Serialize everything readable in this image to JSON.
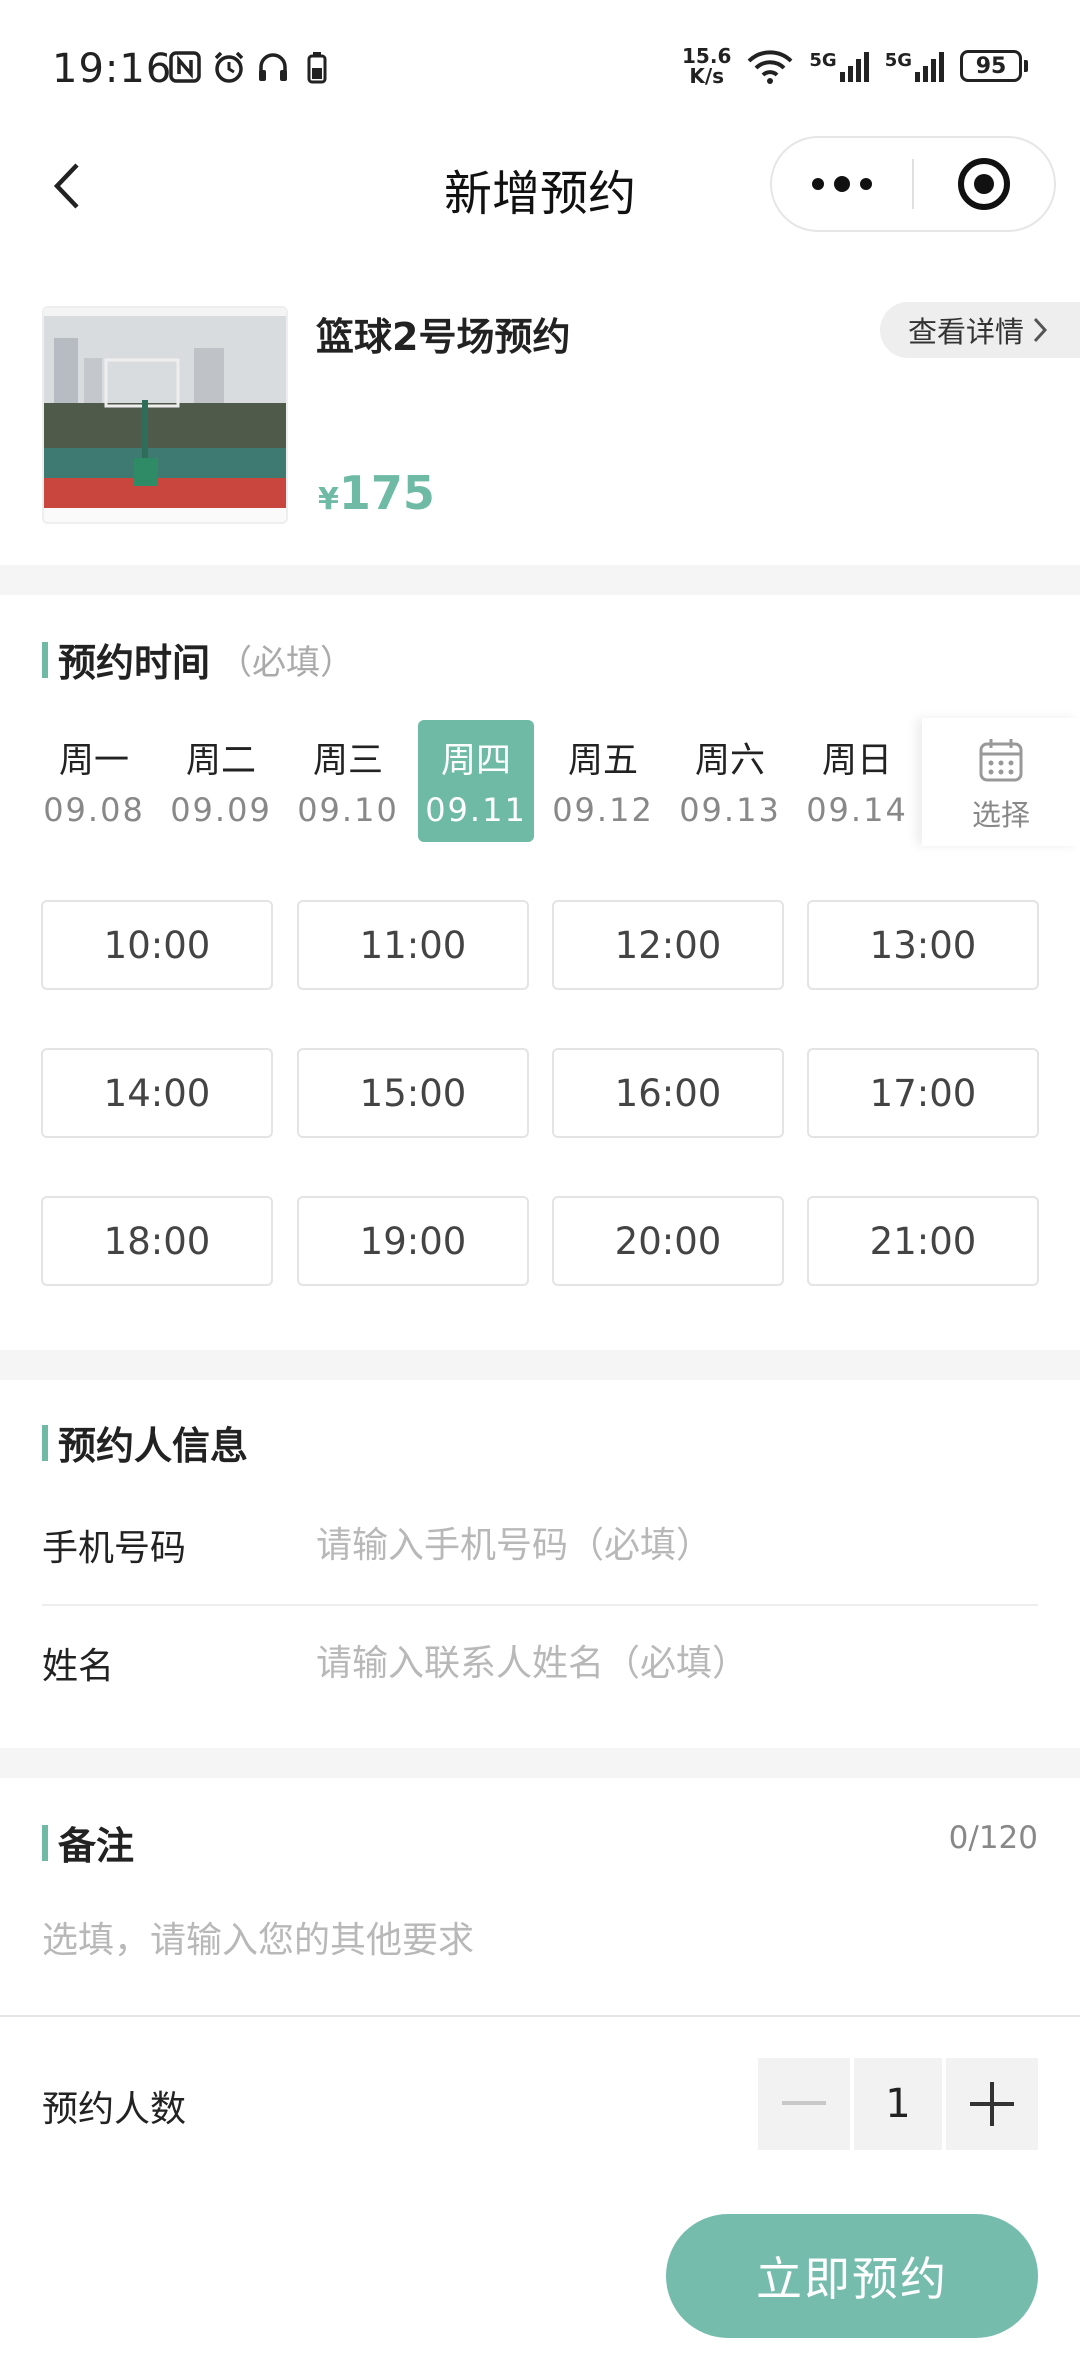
{
  "status_bar": {
    "time": "19:16",
    "net_speed_value": "15.6",
    "net_speed_unit": "K/s",
    "signal_1": "5G",
    "signal_2": "5G",
    "battery": "95"
  },
  "nav": {
    "title": "新增预约"
  },
  "product": {
    "name": "篮球2号场预约",
    "price_symbol": "¥",
    "price": "175",
    "detail_label": "查看详情"
  },
  "booking_time": {
    "title": "预约时间",
    "required_hint": "（必填）",
    "dates": [
      {
        "weekday": "周一",
        "date": "09.08"
      },
      {
        "weekday": "周二",
        "date": "09.09"
      },
      {
        "weekday": "周三",
        "date": "09.10"
      },
      {
        "weekday": "周四",
        "date": "09.11"
      },
      {
        "weekday": "周五",
        "date": "09.12"
      },
      {
        "weekday": "周六",
        "date": "09.13"
      },
      {
        "weekday": "周日",
        "date": "09.14"
      }
    ],
    "selected_date_index": 3,
    "picker_label": "选择",
    "slots": [
      "10:00",
      "11:00",
      "12:00",
      "13:00",
      "14:00",
      "15:00",
      "16:00",
      "17:00",
      "18:00",
      "19:00",
      "20:00",
      "21:00"
    ]
  },
  "booker_info": {
    "title": "预约人信息",
    "phone_label": "手机号码",
    "phone_placeholder": "请输入手机号码（必填）",
    "name_label": "姓名",
    "name_placeholder": "请输入联系人姓名（必填）"
  },
  "remark": {
    "title": "备注",
    "count": "0/120",
    "placeholder": "选填，请输入您的其他要求"
  },
  "people": {
    "label": "预约人数",
    "value": "1"
  },
  "submit_label": "立即预约",
  "colors": {
    "accent": "#6fbaa5",
    "button": "#76bcad"
  }
}
